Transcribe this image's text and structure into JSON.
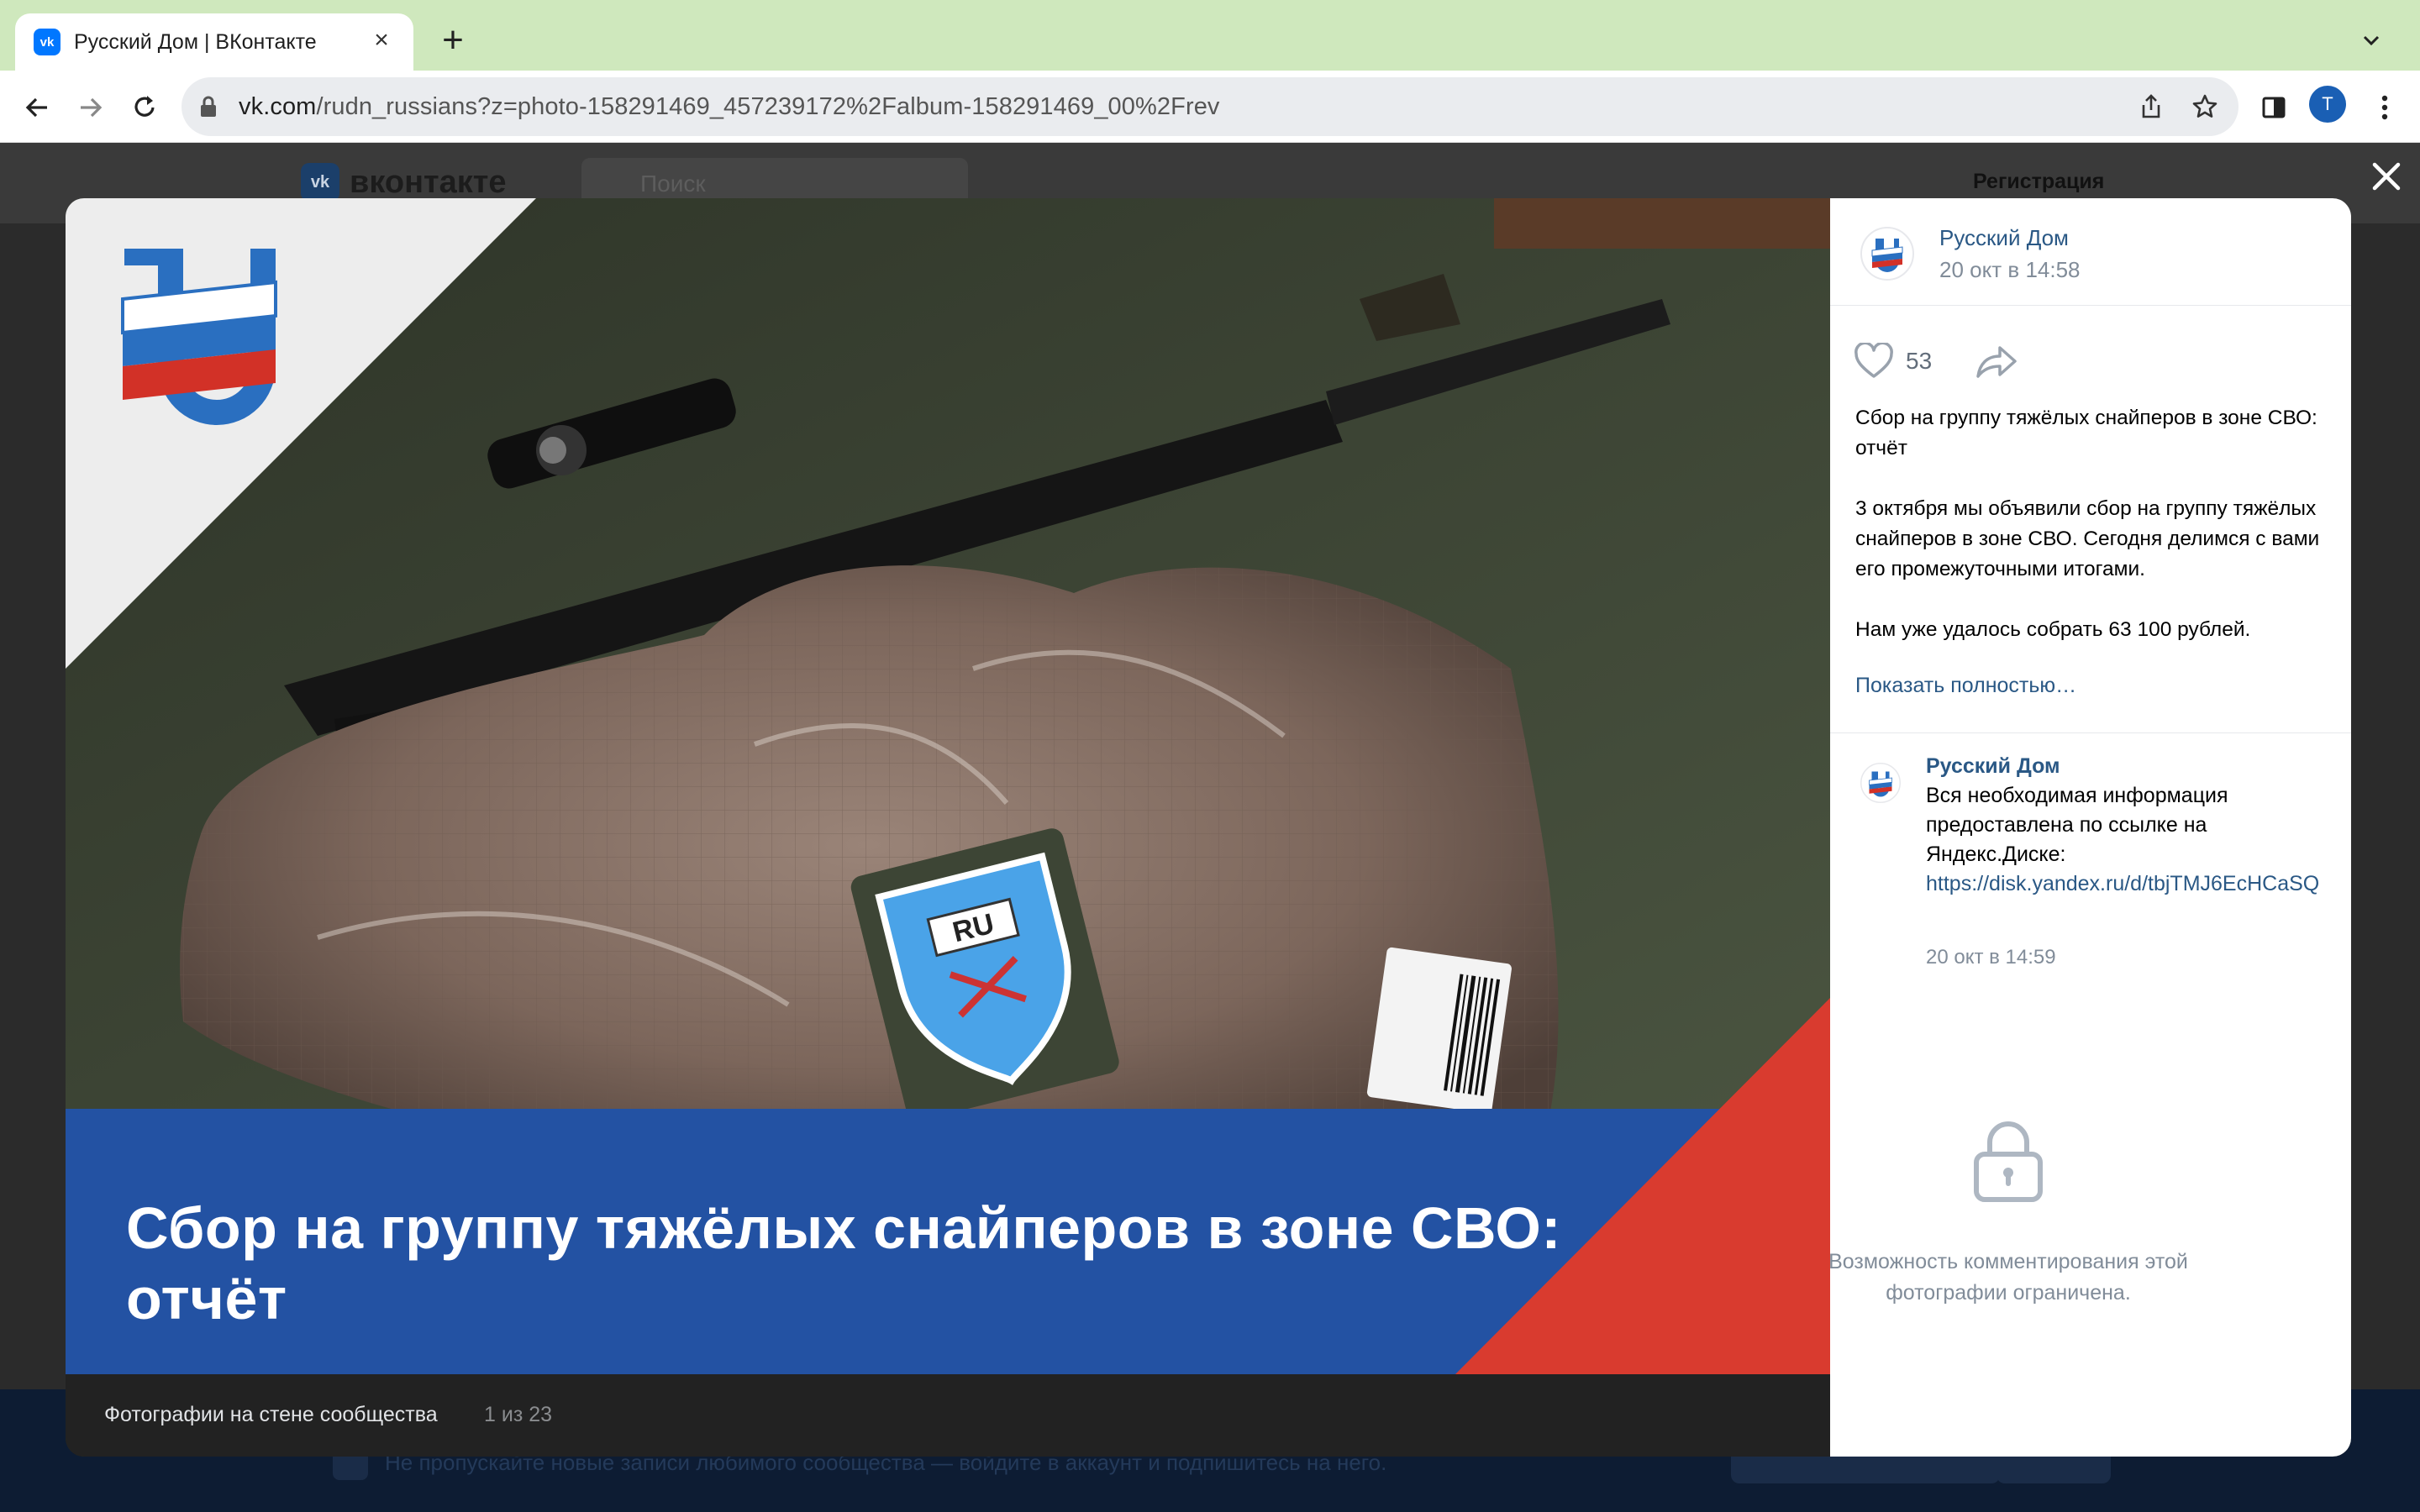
{
  "browser": {
    "tab_title": "Русский Дом | ВКонтакте",
    "favicon_text": "vk",
    "url_host": "vk.com",
    "url_path": "/rudn_russians?z=photo-158291469_457239172%2Falbum-158291469_00%2Frev",
    "profile_initial": "T"
  },
  "background_page": {
    "logo_text": "вконтакте",
    "search_placeholder": "Поиск",
    "register_label": "Регистрация",
    "footer_text": "Не пропускайте новые записи любимого сообщества — войдите в аккаунт и подпишитесь на него."
  },
  "viewer": {
    "headline_line1": "Сбор на группу тяжёлых снайперов в зоне СВО:",
    "headline_line2": "отчёт",
    "patch_text": "RU",
    "album_name": "Фотографии на стене сообщества",
    "counter": "1 из 23"
  },
  "sidebar": {
    "author_name": "Русский Дом",
    "author_time": "20 окт в 14:58",
    "like_count": "53",
    "post_paragraphs": [
      "Сбор на группу тяжёлых снайперов в зоне СВО: отчёт",
      "3 октября мы объявили сбор на группу тяжёлых снайперов в зоне СВО. Сегодня делимся с вами его промежуточными итогами.",
      "Нам уже удалось собрать 63 100 рублей."
    ],
    "show_more": "Показать полностью…",
    "comment": {
      "author": "Русский Дом",
      "text": "Вся необходимая информация предоставлена по ссылке на Яндекс.Диске:",
      "link": "https://disk.yandex.ru/d/tbjTMJ6EcHCaSQ",
      "time": "20 окт в 14:59"
    },
    "comments_locked": "Возможность комментирования этой фотографии ограничена."
  },
  "colors": {
    "vk_blue": "#2a5885",
    "banner_blue": "#2352a3",
    "banner_red": "#d93b2f",
    "meta_gray": "#818c99"
  }
}
